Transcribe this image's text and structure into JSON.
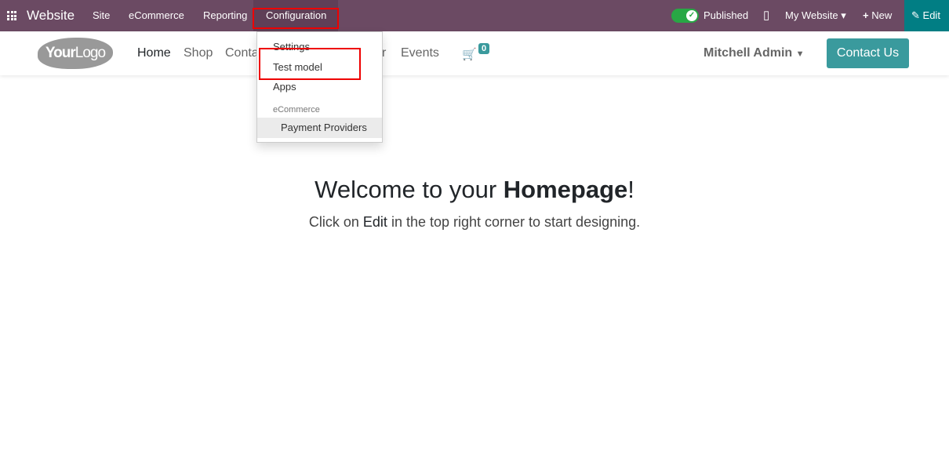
{
  "topbar": {
    "app": "Website",
    "menus": [
      "Site",
      "eCommerce",
      "Reporting",
      "Configuration"
    ],
    "published": "Published",
    "publish_state": true,
    "website": "My Website",
    "new": "New",
    "edit": "Edit",
    "color": "#6b4a63",
    "edit_color": "#017e84"
  },
  "header": {
    "logo": "YourLogo",
    "nav": [
      "Home",
      "Shop",
      "Conta",
      "r",
      "Events"
    ],
    "cart_count": "0",
    "user": "Mitchell Admin",
    "contact": "Contact Us",
    "accent": "#3a9a9d"
  },
  "dropdown": {
    "items": [
      "Settings",
      "Test model",
      "Apps"
    ],
    "section": "eCommerce",
    "sub_item": "Payment Providers"
  },
  "main": {
    "welcome_pre": "Welcome to your ",
    "welcome_bold": "Homepage",
    "welcome_post": "!",
    "sub_pre": "Click on ",
    "sub_bold": "Edit",
    "sub_post": " in the top right corner to start designing."
  }
}
